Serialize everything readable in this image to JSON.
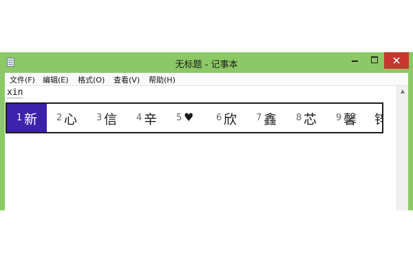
{
  "window": {
    "title": "无标题 - 记事本",
    "icon": "notepad-icon",
    "controls": {
      "minimize": "minimize-icon",
      "maximize": "maximize-icon",
      "close": "close-icon"
    }
  },
  "menu": {
    "items": [
      {
        "label": "文件(F)"
      },
      {
        "label": "编辑(E)"
      },
      {
        "label": "格式(O)"
      },
      {
        "label": "查看(V)"
      },
      {
        "label": "帮助(H)"
      }
    ]
  },
  "editor": {
    "text": "xin"
  },
  "ime": {
    "candidates": [
      {
        "num": "1",
        "char": "新",
        "selected": true
      },
      {
        "num": "2",
        "char": "心"
      },
      {
        "num": "3",
        "char": "信"
      },
      {
        "num": "4",
        "char": "辛"
      },
      {
        "num": "5",
        "char": "♥"
      },
      {
        "num": "6",
        "char": "欣"
      },
      {
        "num": "7",
        "char": "鑫"
      },
      {
        "num": "8",
        "char": "芯"
      },
      {
        "num": "9",
        "char": "馨"
      },
      {
        "num": "",
        "char": "锌"
      }
    ]
  },
  "colors": {
    "window_frame": "#8cc865",
    "close_button": "#c7372f",
    "candidate_selected": "#3d22ab"
  }
}
